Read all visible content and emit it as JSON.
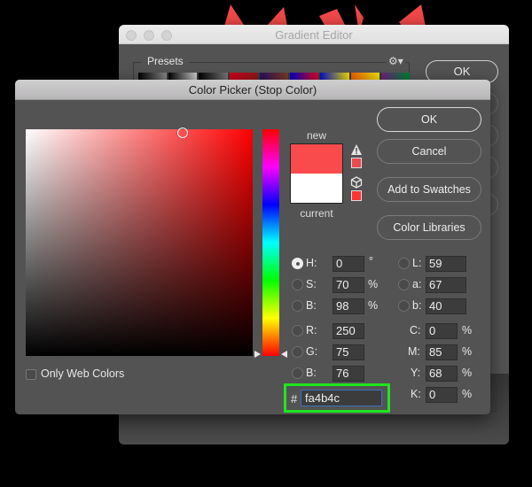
{
  "gradient_editor": {
    "title": "Gradient Editor",
    "presets_label": "Presets",
    "gear_icon": "gear-icon",
    "ok_label": "OK",
    "preset_swatches": [
      "linear-gradient(to right,#000,#888)",
      "linear-gradient(to right,#000,#ccc)",
      "linear-gradient(to right,#000,#777)",
      "linear-gradient(to right,#d0001a,#8a1a1a)",
      "linear-gradient(to right,#2a1060,#7a3a20)",
      "linear-gradient(to right,#0000c8,#e00020)",
      "linear-gradient(to right,#0010d0,#f0e000)",
      "linear-gradient(to right,#f06000,#f0e000)",
      "linear-gradient(to right,#702080,#008030)"
    ]
  },
  "color_picker": {
    "title": "Color Picker (Stop Color)",
    "new_label": "new",
    "current_label": "current",
    "new_color": "#fa4b4c",
    "current_color": "#ffffff",
    "warning_icon": "out-of-gamut-warning-icon",
    "cube_icon": "web-safe-cube-icon",
    "buttons": {
      "ok": "OK",
      "cancel": "Cancel",
      "add_to_swatches": "Add to Swatches",
      "color_libraries": "Color Libraries"
    },
    "only_web_colors": {
      "label": "Only Web Colors",
      "checked": false
    },
    "hsb": {
      "H": {
        "label": "H:",
        "value": "0",
        "unit": "°",
        "selected": true
      },
      "S": {
        "label": "S:",
        "value": "70",
        "unit": "%",
        "selected": false
      },
      "B": {
        "label": "B:",
        "value": "98",
        "unit": "%",
        "selected": false
      }
    },
    "rgb": {
      "R": {
        "label": "R:",
        "value": "250"
      },
      "G": {
        "label": "G:",
        "value": "75"
      },
      "B": {
        "label": "B:",
        "value": "76"
      }
    },
    "lab": {
      "L": {
        "label": "L:",
        "value": "59"
      },
      "a": {
        "label": "a:",
        "value": "67"
      },
      "b": {
        "label": "b:",
        "value": "40"
      }
    },
    "cmyk": {
      "C": {
        "label": "C:",
        "value": "0",
        "unit": "%"
      },
      "M": {
        "label": "M:",
        "value": "85",
        "unit": "%"
      },
      "Y": {
        "label": "Y:",
        "value": "68",
        "unit": "%"
      },
      "K": {
        "label": "K:",
        "value": "0",
        "unit": "%"
      }
    },
    "hex": {
      "label": "#",
      "value": "fa4b4c"
    },
    "hue_slider_value_deg": 0
  }
}
